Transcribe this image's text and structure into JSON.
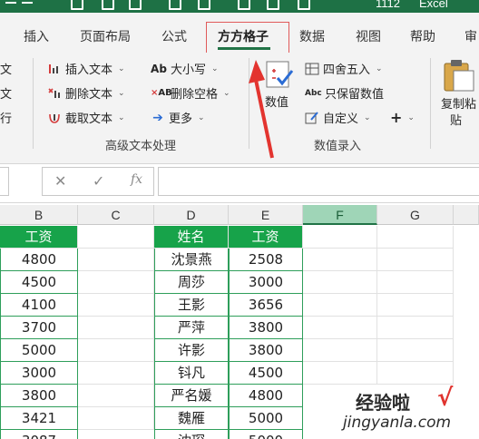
{
  "titlebar": {
    "filename": "1112",
    "app": "Excel"
  },
  "tabs": [
    {
      "label": "插入"
    },
    {
      "label": "页面布局"
    },
    {
      "label": "公式"
    },
    {
      "label": "方方格子"
    },
    {
      "label": "数据"
    },
    {
      "label": "视图"
    },
    {
      "label": "帮助"
    },
    {
      "label": "审"
    }
  ],
  "ribbon": {
    "left_edge": [
      "文",
      "文",
      "行"
    ],
    "advanced_text": {
      "insert_text": "插入文本",
      "delete_text": "删除文本",
      "cut_text": "截取文本",
      "case": "大小写",
      "delete_spaces": "删除空格",
      "more": "更多",
      "group_label": "高级文本处理"
    },
    "number_entry": {
      "numeric": "数值",
      "round": "四舍五入",
      "keep_values": "只保留数值",
      "custom": "自定义",
      "plus": "+",
      "group_label": "数值录入"
    },
    "clipboard": {
      "copy_paste_1": "复制粘",
      "copy_paste_2": "贴"
    }
  },
  "formula_bar": {
    "cancel": "✕",
    "enter": "✓",
    "fx": "fx",
    "value": ""
  },
  "columns": [
    "B",
    "C",
    "D",
    "E",
    "F",
    "G"
  ],
  "selected_column": "F",
  "table_left": {
    "header": "工资",
    "values": [
      "4800",
      "4500",
      "4100",
      "3700",
      "5000",
      "3000",
      "3800",
      "3421",
      "3087"
    ]
  },
  "table_right": {
    "headers": [
      "姓名",
      "工资"
    ],
    "rows": [
      {
        "name": "沈景燕",
        "salary": "2508"
      },
      {
        "name": "周莎",
        "salary": "3000"
      },
      {
        "name": "王影",
        "salary": "3656"
      },
      {
        "name": "严萍",
        "salary": "3800"
      },
      {
        "name": "许影",
        "salary": "3800"
      },
      {
        "name": "钭凡",
        "salary": "4500"
      },
      {
        "name": "严名媛",
        "salary": "4800"
      },
      {
        "name": "魏雁",
        "salary": "5000"
      },
      {
        "name": "沈琛",
        "salary": "5000"
      }
    ]
  },
  "watermark": {
    "main": "经验啦",
    "check": "√",
    "sub": "jingyanla.com"
  },
  "colors": {
    "excel_green": "#217346",
    "header_fill": "#17a34a",
    "highlight_red": "#e05a5a",
    "selected_col": "#9fd5b7"
  }
}
